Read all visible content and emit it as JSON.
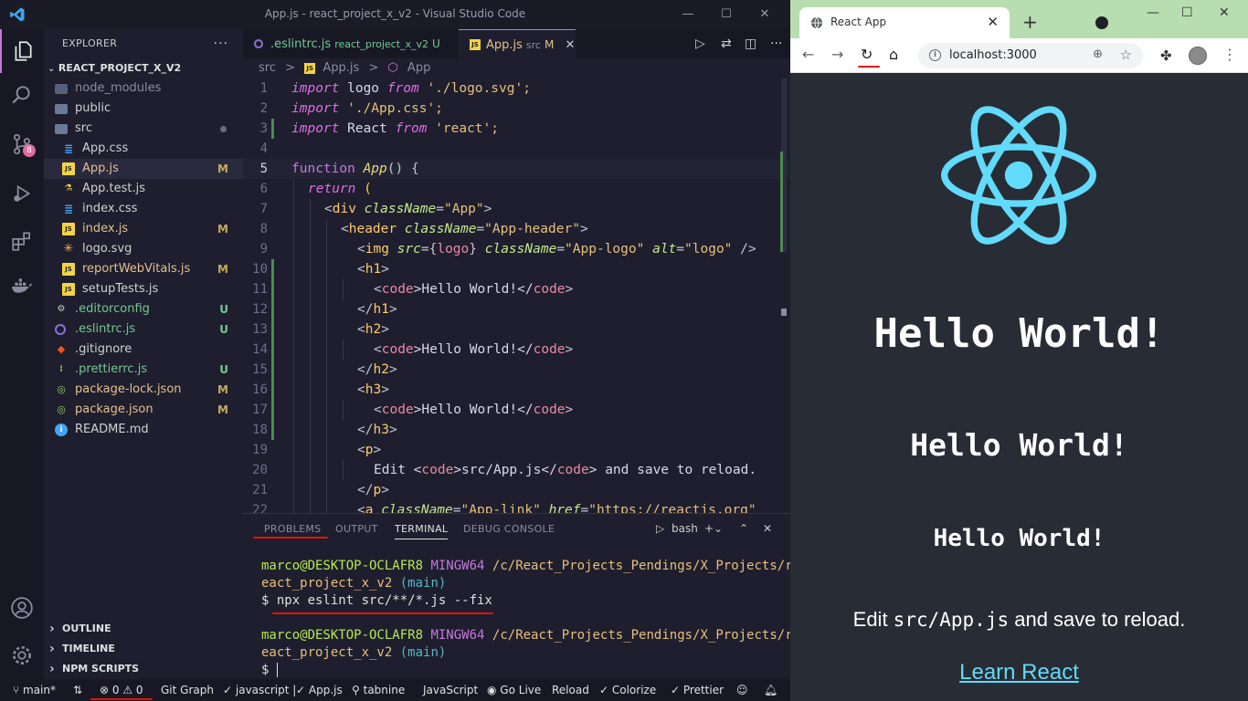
{
  "vscode": {
    "window_title": "App.js - react_project_x_v2 - Visual Studio Code",
    "explorer": {
      "header": "EXPLORER",
      "project": "REACT_PROJECT_X_V2",
      "items": [
        {
          "name": "node_modules",
          "type": "folder",
          "status": ""
        },
        {
          "name": "public",
          "type": "folder",
          "status": ""
        },
        {
          "name": "src",
          "type": "folder",
          "status": ""
        },
        {
          "name": "App.css",
          "type": "css",
          "status": ""
        },
        {
          "name": "App.js",
          "type": "js",
          "status": "M"
        },
        {
          "name": "App.test.js",
          "type": "test",
          "status": ""
        },
        {
          "name": "index.css",
          "type": "css",
          "status": ""
        },
        {
          "name": "index.js",
          "type": "js",
          "status": "M"
        },
        {
          "name": "logo.svg",
          "type": "svg",
          "status": ""
        },
        {
          "name": "reportWebVitals.js",
          "type": "js",
          "status": "M"
        },
        {
          "name": "setupTests.js",
          "type": "js",
          "status": ""
        },
        {
          "name": ".editorconfig",
          "type": "gear",
          "status": "U"
        },
        {
          "name": ".eslintrc.js",
          "type": "eslint",
          "status": "U"
        },
        {
          "name": ".gitignore",
          "type": "git",
          "status": ""
        },
        {
          "name": ".prettierrc.js",
          "type": "prettier",
          "status": "U"
        },
        {
          "name": "package-lock.json",
          "type": "json",
          "status": "M"
        },
        {
          "name": "package.json",
          "type": "json",
          "status": "M"
        },
        {
          "name": "README.md",
          "type": "info",
          "status": ""
        }
      ],
      "sections": [
        "OUTLINE",
        "TIMELINE",
        "NPM SCRIPTS"
      ]
    },
    "activity_badge": "8",
    "tabs": [
      {
        "label": ".eslintrc.js",
        "desc": "react_project_x_v2",
        "flag": "U",
        "active": false
      },
      {
        "label": "App.js",
        "desc": "src",
        "flag": "M",
        "active": true
      }
    ],
    "breadcrumb": [
      "src",
      ">",
      "App.js",
      ">",
      "App"
    ],
    "code_lines": [
      "1",
      "2",
      "3",
      "4",
      "5",
      "6",
      "7",
      "8",
      "9",
      "10",
      "11",
      "12",
      "13",
      "14",
      "15",
      "16",
      "17",
      "18",
      "19",
      "20",
      "21",
      "22"
    ],
    "code": {
      "l1": [
        "import",
        " logo ",
        "from",
        " './logo.svg';"
      ],
      "l2": [
        "import",
        " './App.css';"
      ],
      "l3": [
        "import",
        " React ",
        "from",
        " 'react';"
      ],
      "l5": [
        "function",
        " ",
        "App",
        "() {"
      ],
      "l6": [
        "return",
        " ("
      ],
      "l7": [
        "<",
        "div",
        " ",
        "className",
        "=",
        "\"App\"",
        ">"
      ],
      "l8": [
        "<",
        "header",
        " ",
        "className",
        "=",
        "\"App-header\"",
        ">"
      ],
      "l9": [
        "<",
        "img",
        " ",
        "src",
        "={",
        "logo",
        "} ",
        "className",
        "=",
        "\"App-logo\"",
        " ",
        "alt",
        "=",
        "\"logo\"",
        " />"
      ],
      "l10": [
        "<",
        "h1",
        ">"
      ],
      "l11": [
        "<",
        "code",
        ">Hello World!</",
        "code",
        ">"
      ],
      "l12": [
        "</",
        "h1",
        ">"
      ],
      "l13": [
        "<",
        "h2",
        ">"
      ],
      "l14": [
        "<",
        "code",
        ">Hello World!</",
        "code",
        ">"
      ],
      "l15": [
        "</",
        "h2",
        ">"
      ],
      "l16": [
        "<",
        "h3",
        ">"
      ],
      "l17": [
        "<",
        "code",
        ">Hello World!</",
        "code",
        ">"
      ],
      "l18": [
        "</",
        "h3",
        ">"
      ],
      "l19": [
        "<",
        "p",
        ">"
      ],
      "l20": [
        "Edit <",
        "code",
        ">src/App.js</",
        "code",
        "> and save to reload."
      ],
      "l21": [
        "</",
        "p",
        ">"
      ],
      "l22": [
        "<",
        "a",
        " ",
        "className",
        "=",
        "\"App-link\"",
        " ",
        "href",
        "=",
        "\"https://reactjs.org\""
      ]
    },
    "panel": {
      "tabs": [
        "PROBLEMS",
        "OUTPUT",
        "TERMINAL",
        "DEBUG CONSOLE"
      ],
      "active_tab": "TERMINAL",
      "shell": "bash"
    },
    "terminal": {
      "user": "marco@DESKTOP-OCLAFR8",
      "env": "MINGW64",
      "path1": "/c/React_Projects_Pendings/X_Projects/r",
      "path2": "eact_project_x_v2",
      "branch": "(main)",
      "command": "$ npx eslint src/**/*.js --fix",
      "prompt": "$"
    },
    "status": {
      "branch": "main*",
      "errors": "0",
      "warnings": "0",
      "items": [
        "Git Graph",
        "javascript |",
        "App.js",
        "tabnine",
        "JavaScript",
        "Go Live",
        "Reload",
        "Colorize",
        "Prettier"
      ]
    },
    "accent_color": "#c678dd",
    "annotation_color": "#e51400"
  },
  "browser": {
    "tab_title": "React App",
    "url": "localhost:3000",
    "page": {
      "h1": "Hello World!",
      "h2": "Hello World!",
      "h3": "Hello World!",
      "p_before": "Edit ",
      "p_code": "src/App.js",
      "p_after": " and save to reload.",
      "link": "Learn React",
      "react_color": "#61dafb",
      "bg_color": "#282c34"
    }
  }
}
